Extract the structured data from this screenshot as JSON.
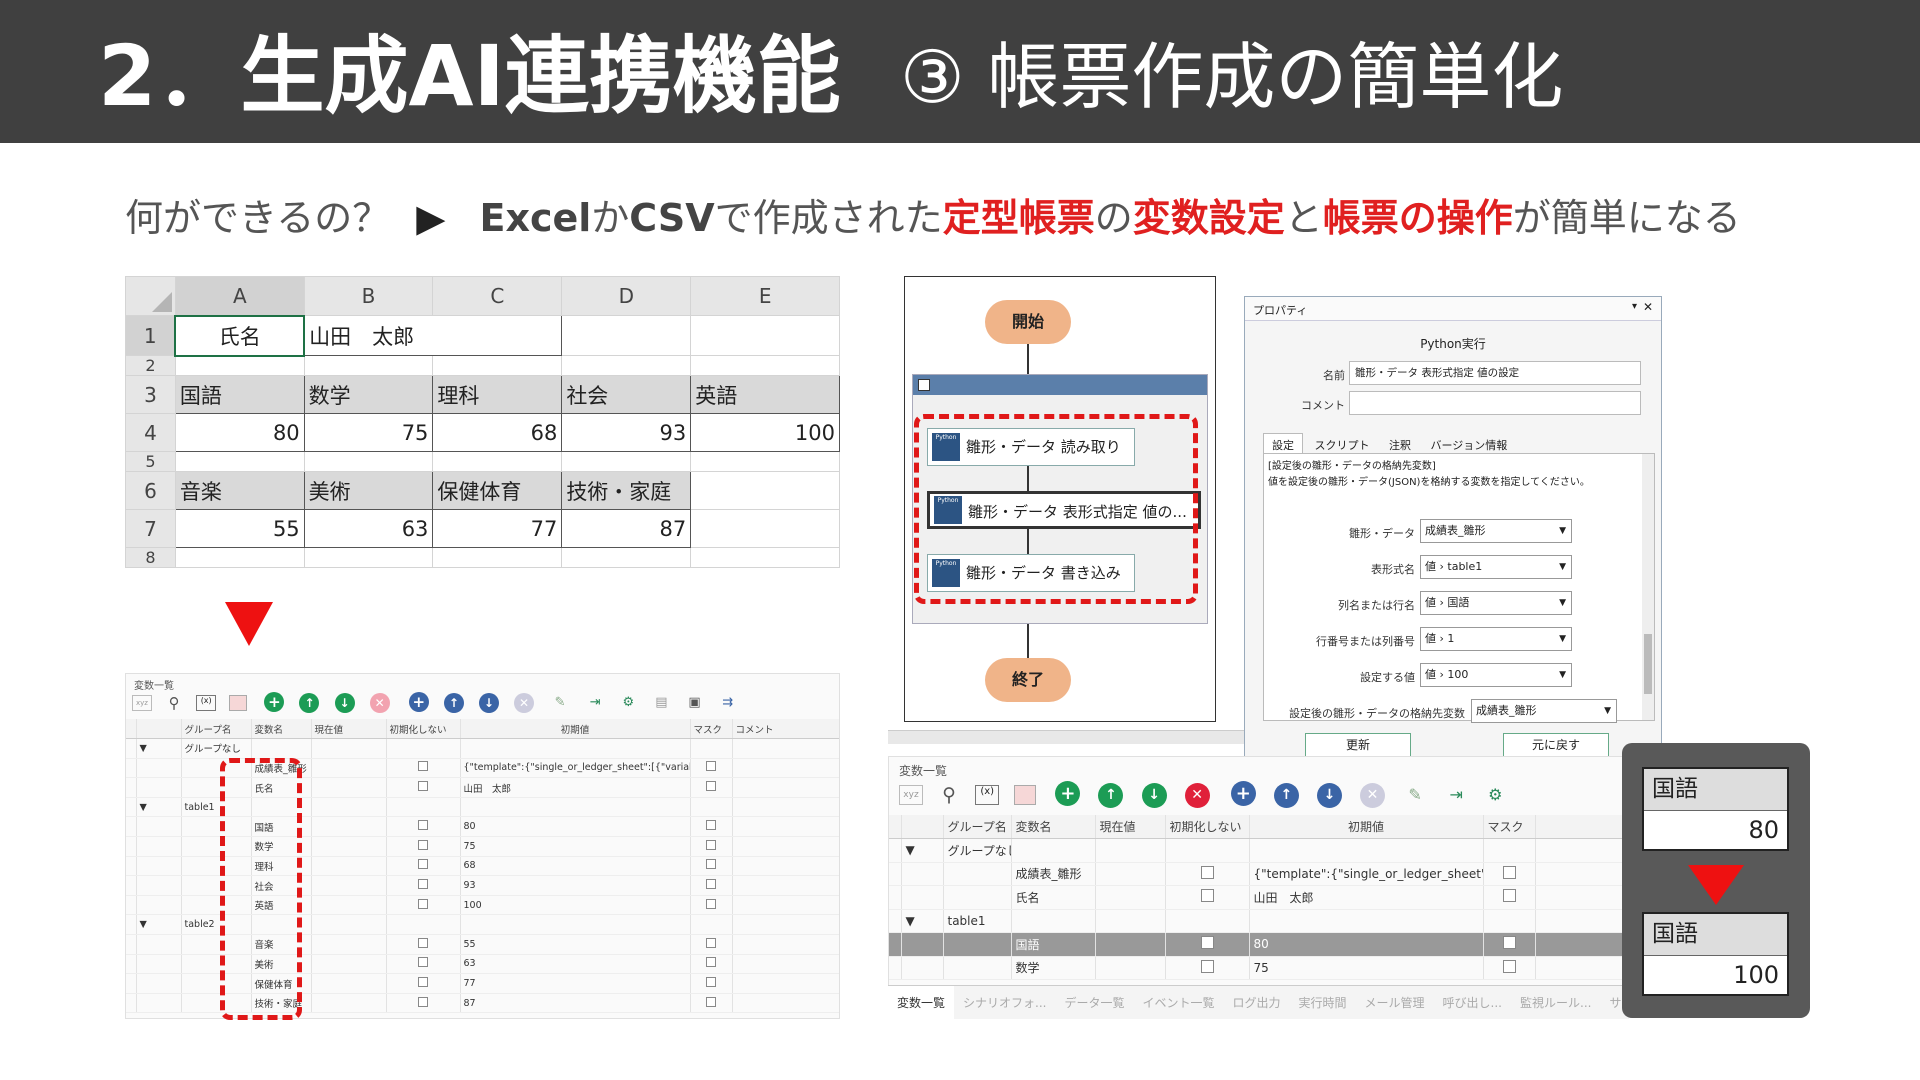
{
  "header": {
    "title_main": "2．生成AI連携機能",
    "title_sub": "③ 帳票作成の簡単化"
  },
  "subline": {
    "q": "何ができるの？",
    "arrow": "▶",
    "p1": "Excel",
    "p2": "か",
    "p3": "CSV",
    "p4": "で作成された",
    "p5": "定型帳票",
    "p6": "の",
    "p7": "変数設定",
    "p8": "と",
    "p9": "帳票の操作",
    "p10": "が簡単になる"
  },
  "excel": {
    "columns": [
      "A",
      "B",
      "C",
      "D",
      "E"
    ],
    "row_numbers": [
      "1",
      "2",
      "3",
      "4",
      "5",
      "6",
      "7",
      "8"
    ],
    "r1": {
      "a": "氏名",
      "b": "山田　太郎"
    },
    "r3": [
      "国語",
      "数学",
      "理科",
      "社会",
      "英語"
    ],
    "r4": [
      "80",
      "75",
      "68",
      "93",
      "100"
    ],
    "r6": [
      "音楽",
      "美術",
      "保健体育",
      "技術・家庭"
    ],
    "r7": [
      "55",
      "63",
      "77",
      "87"
    ]
  },
  "var_left": {
    "title": "変数一覧",
    "headers": [
      "グループ名",
      "変数名",
      "現在値",
      "初期化しない",
      "初期値",
      "マスク",
      "コメント"
    ],
    "group_none": "グループなし",
    "table1": "table1",
    "table2": "table2",
    "rows": [
      {
        "name": "成績表_雛形",
        "init": "{\"template\":{\"single_or_ledger_sheet\":[{\"variab"
      },
      {
        "name": "氏名",
        "init": "山田　太郎"
      },
      {
        "name": "国語",
        "init": "80"
      },
      {
        "name": "数学",
        "init": "75"
      },
      {
        "name": "理科",
        "init": "68"
      },
      {
        "name": "社会",
        "init": "93"
      },
      {
        "name": "英語",
        "init": "100"
      },
      {
        "name": "音楽",
        "init": "55"
      },
      {
        "name": "美術",
        "init": "63"
      },
      {
        "name": "保健体育",
        "init": "77"
      },
      {
        "name": "技術・家庭",
        "init": "87"
      }
    ]
  },
  "flow": {
    "start": "開始",
    "end": "終了",
    "py": "Python",
    "step1": "雛形・データ 読み取り",
    "step2": "雛形・データ 表形式指定 値の...",
    "step3": "雛形・データ 書き込み"
  },
  "props": {
    "title": "プロパティ",
    "heading": "Python実行",
    "name_label": "名前",
    "name_value": "雛形・データ 表形式指定 値の設定",
    "comment_label": "コメント",
    "tabs": [
      "設定",
      "スクリプト",
      "注釈",
      "バージョン情報"
    ],
    "desc1": "[設定後の雛形・データの格納先変数]",
    "desc2": "値を設定後の雛形・データ(JSON)を格納する変数を指定してください。",
    "f1_label": "雛形・データ",
    "f1_value": "成績表_雛形",
    "f2_label": "表形式名",
    "f2_value": "値 › table1",
    "f3_label": "列名または行名",
    "f3_value": "値 › 国語",
    "f4_label": "行番号または列番号",
    "f4_value": "値 › 1",
    "f5_label": "設定する値",
    "f5_value": "値 › 100",
    "f6_label": "設定後の雛形・データの格納先変数",
    "f6_value": "成績表_雛形",
    "update": "更新",
    "revert": "元に戻す"
  },
  "var_right": {
    "title": "変数一覧",
    "headers": [
      "グループ名",
      "変数名",
      "現在値",
      "初期化しない",
      "初期値",
      "マスク"
    ],
    "group_none": "グループなし",
    "table1": "table1",
    "rows": [
      {
        "name": "成績表_雛形",
        "init": "{\"template\":{\"single_or_ledger_sheet\":[{\""
      },
      {
        "name": "氏名",
        "init": "山田　太郎"
      },
      {
        "name": "国語",
        "init": "80"
      },
      {
        "name": "数学",
        "init": "75"
      }
    ]
  },
  "bottom_tabs": [
    "変数一覧",
    "シナリオフォ...",
    "データ一覧",
    "イベント一覧",
    "ログ出力",
    "実行時間",
    "メール管理",
    "呼び出し...",
    "監視ルール...",
    "サブル"
  ],
  "callout": {
    "label1": "国語",
    "value1": "80",
    "label2": "国語",
    "value2": "100"
  },
  "colors": {
    "header_bg": "#404040",
    "accent_red": "#e02020",
    "flow_node": "#f0b489",
    "python_icon": "#2c5483"
  }
}
